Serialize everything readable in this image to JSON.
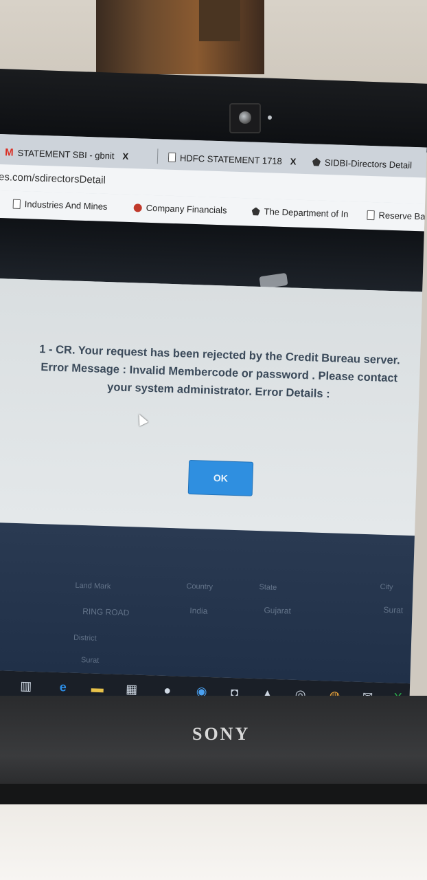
{
  "browser": {
    "tabs": [
      {
        "icon": "gmail-icon",
        "label": "STATEMENT SBI - gbnit",
        "close": "X"
      },
      {
        "icon": "document-icon",
        "label": "HDFC STATEMENT 1718",
        "close": "X"
      },
      {
        "icon": "emblem-icon",
        "label": "SIDBI-Directors Detail"
      }
    ],
    "url": "es.com/sdirectorsDetail",
    "bookmarks": [
      {
        "icon": "document-icon",
        "label": "Industries And Mines"
      },
      {
        "icon": "company-financials-icon",
        "label": "Company Financials"
      },
      {
        "icon": "emblem-icon",
        "label": "The Department of In"
      },
      {
        "icon": "document-icon",
        "label": "Reserve Bank"
      }
    ]
  },
  "dialog": {
    "line1": "1 - CR. Your request has been rejected by the Credit Bureau server.",
    "line2": "Error Message : Invalid Membercode or password . Please contact",
    "line3": "your system administrator. Error Details :",
    "ok_label": "OK"
  },
  "form_ghost": {
    "landmark_label": "Land Mark",
    "country_label": "Country",
    "state_label": "State",
    "city_label": "City",
    "address_value": "RING ROAD",
    "country_value": "India",
    "state_value": "Gujarat",
    "city_value": "Surat",
    "district_label": "District",
    "district_value": "Surat"
  },
  "taskbar_icons": [
    "search-icon",
    "task-view-icon",
    "edge-icon",
    "file-explorer-icon",
    "store-icon",
    "people-icon",
    "app-icon",
    "app-icon-2",
    "app-icon-3",
    "app-icon-4",
    "chrome-icon",
    "mail-icon",
    "excel-icon"
  ],
  "laptop_brand": "SONY"
}
